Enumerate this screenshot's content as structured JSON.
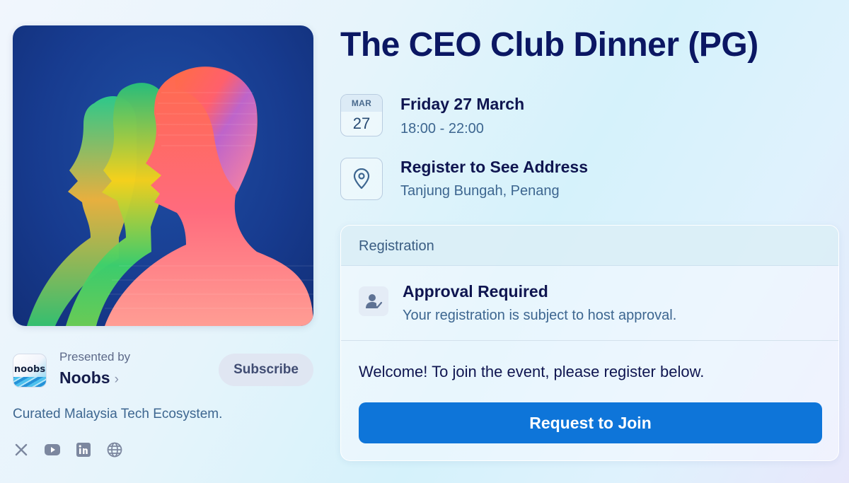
{
  "event": {
    "title": "The CEO Club Dinner (PG)",
    "cover_image": "colorful-layered-head-silhouettes"
  },
  "date": {
    "month": "MAR",
    "day": "27",
    "full": "Friday 27 March",
    "time": "18:00 - 22:00"
  },
  "location": {
    "icon": "map-pin-icon",
    "title": "Register to See Address",
    "area": "Tanjung Bungah, Penang"
  },
  "registration": {
    "header": "Registration",
    "approval_icon": "user-check-icon",
    "approval_title": "Approval Required",
    "approval_sub": "Your registration is subject to host approval.",
    "welcome": "Welcome! To join the event, please register below.",
    "join_label": "Request to Join"
  },
  "host": {
    "presented_by": "Presented by",
    "name": "Noobs",
    "logo_text": "noobs",
    "subscribe_label": "Subscribe",
    "description": "Curated Malaysia Tech Ecosystem.",
    "socials": [
      "x-icon",
      "youtube-icon",
      "linkedin-icon",
      "globe-icon"
    ]
  },
  "colors": {
    "primary_button": "#0e75d9",
    "title": "#0b1763",
    "muted_text": "#3d6690"
  }
}
